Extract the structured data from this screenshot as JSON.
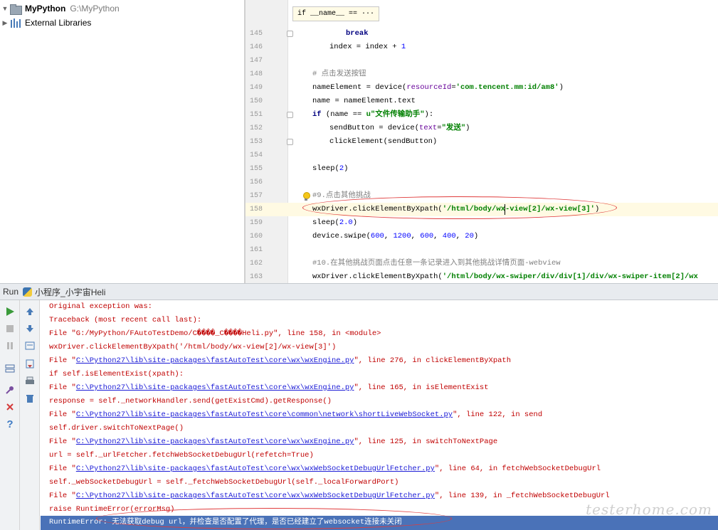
{
  "project": {
    "root_name": "MyPython",
    "root_path": "G:\\MyPython",
    "external_libraries": "External Libraries"
  },
  "editor": {
    "breadcrumb": "if __name__ == ···",
    "lines": [
      {
        "num": "145",
        "text": "break"
      },
      {
        "num": "146",
        "text": "index = index + 1"
      },
      {
        "num": "147",
        "text": ""
      },
      {
        "num": "148",
        "text": "# 点击发送按钮"
      },
      {
        "num": "149",
        "text": "nameElement = device(resourceId='com.tencent.mm:id/am8')"
      },
      {
        "num": "150",
        "text": "name = nameElement.text"
      },
      {
        "num": "151",
        "text": "if (name == u\"文件传输助手\"):"
      },
      {
        "num": "152",
        "text": "sendButton = device(text=\"发送\")"
      },
      {
        "num": "153",
        "text": "clickElement(sendButton)"
      },
      {
        "num": "154",
        "text": ""
      },
      {
        "num": "155",
        "text": "sleep(2)"
      },
      {
        "num": "156",
        "text": ""
      },
      {
        "num": "157",
        "text": "#9.点击其他挑战"
      },
      {
        "num": "158",
        "text": "wxDriver.clickElementByXpath('/html/body/wx-view[2]/wx-view[3]')"
      },
      {
        "num": "159",
        "text": "sleep(2.0)"
      },
      {
        "num": "160",
        "text": "device.swipe(600, 1200, 600, 400, 20)"
      },
      {
        "num": "161",
        "text": ""
      },
      {
        "num": "162",
        "text": "#10.在其他挑战页面点击任意一条记录进入到其他挑战详情页面-webview"
      },
      {
        "num": "163",
        "text": "wxDriver.clickElementByXpath('/html/body/wx-swiper/div/div[1]/div/wx-swiper-item[2]/wx"
      }
    ]
  },
  "run": {
    "label": "Run",
    "config_name": "小程序_小宇宙Heli"
  },
  "console": {
    "lines": [
      "Original exception was:",
      "Traceback (most recent call last):",
      "  File \"G:/MyPython/FAutoTestDemo/С����_С����Heli.py\", line 158, in <module>",
      "    wxDriver.clickElementByXpath('/html/body/wx-view[2]/wx-view[3]')",
      "    if self.isElementExist(xpath):",
      "    response = self._networkHandler.send(getExistCmd).getResponse()",
      "    self.driver.switchToNextPage()",
      "    url = self._urlFetcher.fetchWebSocketDebugUrl(refetch=True)",
      "    self._webSocketDebugUrl = self._fetchWebSocketDebugUrl(self._localForwardPort)",
      "    raise RuntimeError(errorMsg)"
    ],
    "file_links": [
      {
        "prefix": "  File \"",
        "path": "C:\\Python27\\lib\\site-packages\\fastAutoTest\\core\\wx\\wxEngine.py",
        "suffix": "\", line 276, in clickElementByXpath"
      },
      {
        "prefix": "  File \"",
        "path": "C:\\Python27\\lib\\site-packages\\fastAutoTest\\core\\wx\\wxEngine.py",
        "suffix": "\", line 165, in isElementExist"
      },
      {
        "prefix": "  File \"",
        "path": "C:\\Python27\\lib\\site-packages\\fastAutoTest\\core\\common\\network\\shortLiveWebSocket.py",
        "suffix": "\", line 122, in send"
      },
      {
        "prefix": "  File \"",
        "path": "C:\\Python27\\lib\\site-packages\\fastAutoTest\\core\\wx\\wxEngine.py",
        "suffix": "\", line 125, in switchToNextPage"
      },
      {
        "prefix": "  File \"",
        "path": "C:\\Python27\\lib\\site-packages\\fastAutoTest\\core\\wx\\wxWebSocketDebugUrlFetcher.py",
        "suffix": "\", line 64, in fetchWebSocketDebugUrl"
      },
      {
        "prefix": "  File \"",
        "path": "C:\\Python27\\lib\\site-packages\\fastAutoTest\\core\\wx\\wxWebSocketDebugUrlFetcher.py",
        "suffix": "\", line 139, in _fetchWebSocketDebugUrl"
      }
    ],
    "error_line": "RuntimeError: 无法获取debug url，并检查是否配置了代理，是否已经建立了websocket连接未关闭",
    "watermark": "testerhome.com"
  },
  "colors": {
    "error_text": "#c00000",
    "link": "#1a1ad6",
    "highlight_row": "#4a72b8",
    "annotation_oval": "#e03c3c"
  }
}
